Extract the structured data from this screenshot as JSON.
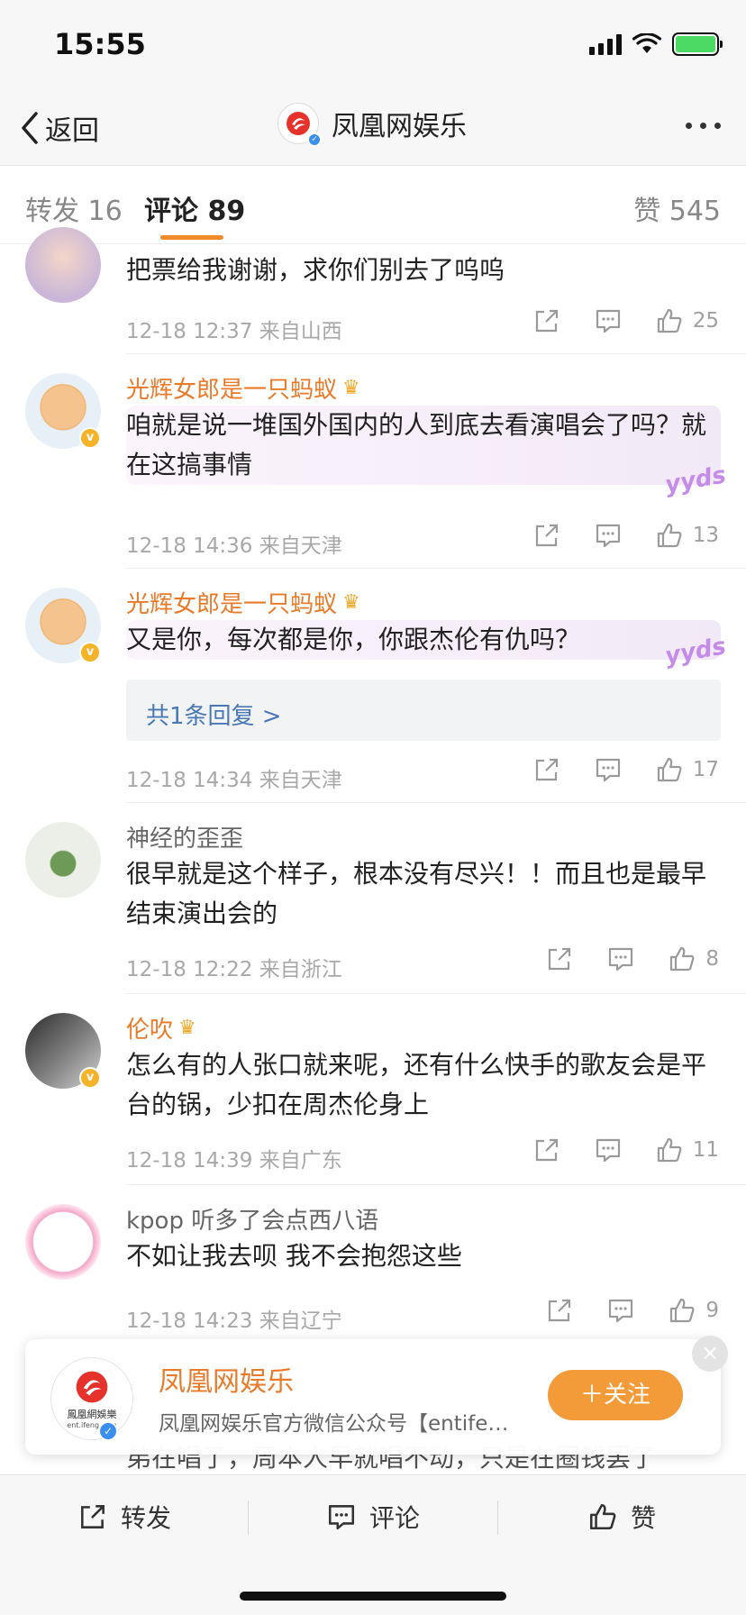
{
  "status": {
    "time": "15:55"
  },
  "nav": {
    "back_label": "返回",
    "title": "凤凰网娱乐"
  },
  "tabs": {
    "repost": "转发 16",
    "comment": "评论 89",
    "like": "赞 545"
  },
  "comments": [
    {
      "name": "",
      "text": "把票给我谢谢，求你们别去了呜呜",
      "time": "12-18 12:37",
      "location": "来自山西",
      "likes": "25"
    },
    {
      "name": "光辉女郎是一只蚂蚁",
      "text": "咱就是说一堆国外国内的人到底去看演唱会了吗？就在这搞事情",
      "badge": "yyds",
      "time": "12-18 14:36",
      "location": "来自天津",
      "likes": "13"
    },
    {
      "name": "光辉女郎是一只蚂蚁",
      "text": "又是你，每次都是你，你跟杰伦有仇吗？",
      "badge": "yyds",
      "reply_label": "共1条回复 >",
      "time": "12-18 14:34",
      "location": "来自天津",
      "likes": "17"
    },
    {
      "name": "神经的歪歪",
      "text": "很早就是这个样子，根本没有尽兴！！而且也是最早结束演出会的",
      "time": "12-18 12:22",
      "location": "来自浙江",
      "likes": "8"
    },
    {
      "name": "伦吹",
      "text": "怎么有的人张口就来呢，还有什么快手的歌友会是平台的锅，少扣在周杰伦身上",
      "time": "12-18 14:39",
      "location": "来自广东",
      "likes": "11"
    },
    {
      "name": "kpop 听多了会点西八语",
      "text": "不如让我去呗 我不会抱怨这些",
      "time": "12-18 14:23",
      "location": "来自辽宁",
      "likes": "9"
    }
  ],
  "follow_card": {
    "name": "凤凰网娱乐",
    "desc": "凤凰网娱乐官方微信公众号【entife…",
    "follow_label": "＋关注",
    "logo_text": "鳳凰網娛樂",
    "logo_sub": "ent.ifeng.com",
    "close_icon": "×"
  },
  "behind_text": "弟在唱了，周本人早就唱不动，只是在圈钱罢了",
  "bottom_bar": {
    "repost": "转发",
    "comment": "评论",
    "like": "赞"
  },
  "colors": {
    "accent": "#f08a2a",
    "username": "#e97a2a",
    "link": "#4a78b5",
    "follow": "#f29b38"
  }
}
